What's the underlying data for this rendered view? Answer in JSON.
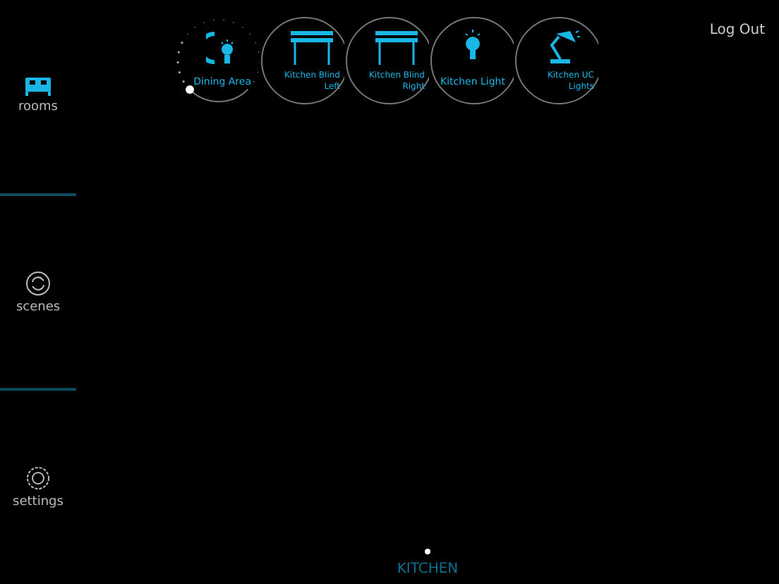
{
  "sidebar": {
    "items": [
      {
        "label": "rooms",
        "kind": "rooms",
        "selected": true
      },
      {
        "label": "scenes",
        "kind": "scenes",
        "selected": false
      },
      {
        "label": "settings",
        "kind": "settings",
        "selected": false
      }
    ]
  },
  "devices": [
    {
      "kind": "dimmer",
      "label": "Dining Area",
      "level": 0.3
    },
    {
      "kind": "blind",
      "label": "Kitchen Blind Left"
    },
    {
      "kind": "blind",
      "label": "Kitchen Blind Right"
    },
    {
      "kind": "light",
      "label": "Kitchen Light"
    },
    {
      "kind": "lamp",
      "label": "Kitchen UC Lights"
    }
  ],
  "logout": "Log Out",
  "pages": [
    {
      "selected": true
    }
  ],
  "room_title": "KITCHEN"
}
